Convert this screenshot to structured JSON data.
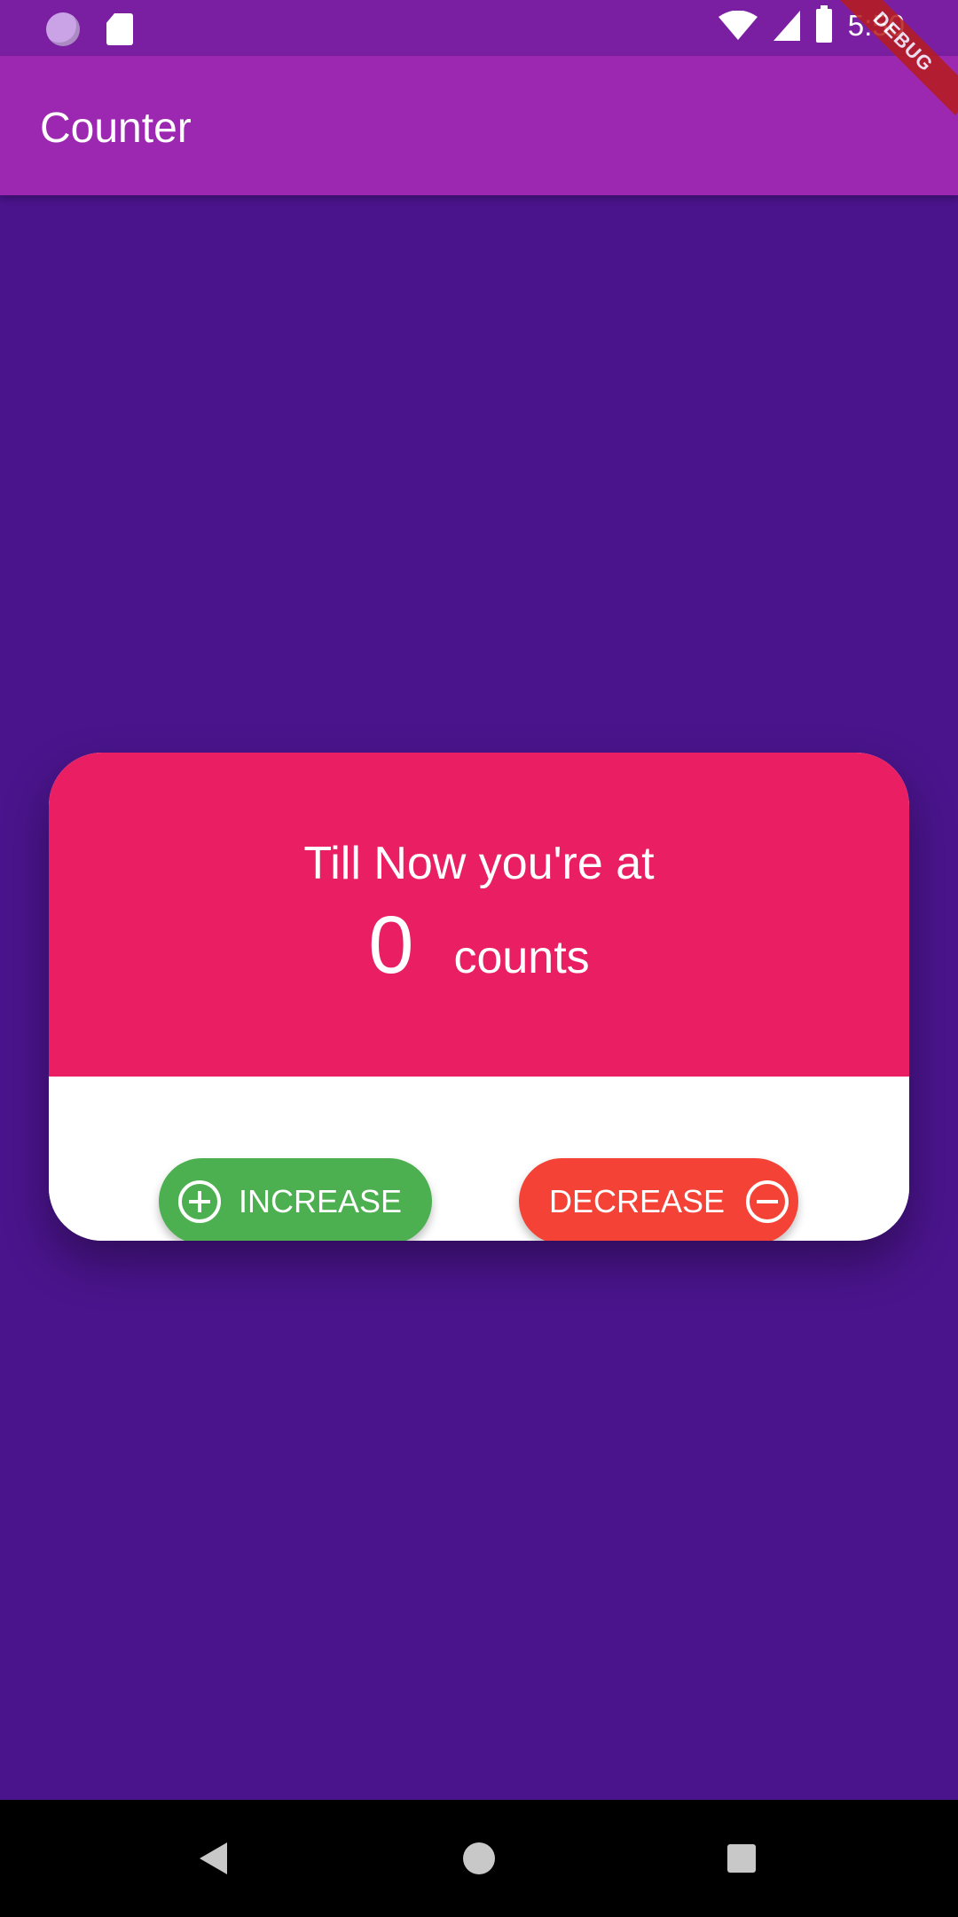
{
  "status_bar": {
    "time": "5:50",
    "icons": [
      "notification-circle-icon",
      "sd-card-icon",
      "wifi-icon",
      "signal-icon",
      "battery-icon"
    ]
  },
  "debug_banner": "DEBUG",
  "app_bar": {
    "title": "Counter"
  },
  "card": {
    "headline": "Till Now you're at",
    "count_value": "0",
    "count_unit": "counts",
    "increase_label": "INCREASE",
    "decrease_label": "DECREASE"
  },
  "colors": {
    "background": "#4a148c",
    "app_bar": "#9c27b0",
    "status_bar": "#7b1fa2",
    "card_top": "#e91e63",
    "increase": "#4caf50",
    "decrease": "#f44336"
  },
  "nav_bar": {
    "icons": [
      "back-icon",
      "home-icon",
      "recents-icon"
    ]
  }
}
